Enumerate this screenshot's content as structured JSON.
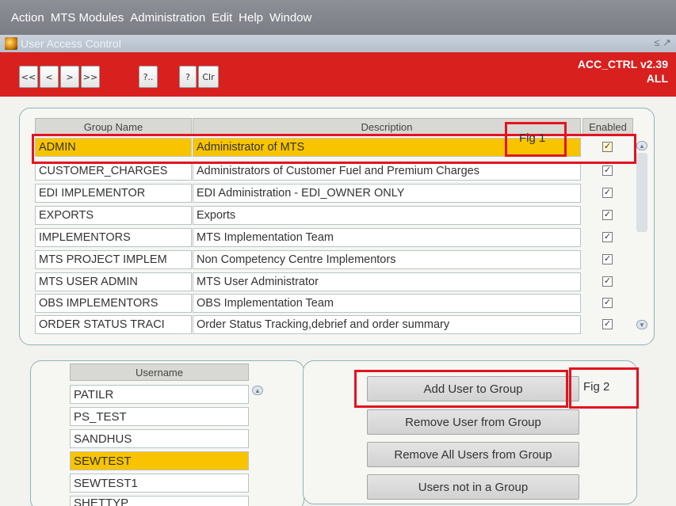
{
  "menu": {
    "items": [
      "Action",
      "MTS Modules",
      "Administration",
      "Edit",
      "Help",
      "Window"
    ]
  },
  "window": {
    "title": "User Access Control",
    "controls": "≤ ↗"
  },
  "toolbar": {
    "buttons": [
      "<<",
      "<",
      ">",
      ">>",
      "?..",
      "?",
      "Clr"
    ],
    "form_id": "ACC_CTRL v2.39",
    "scope": "ALL"
  },
  "groups": {
    "headers": {
      "name": "Group Name",
      "description": "Description",
      "enabled": "Enabled"
    },
    "rows": [
      {
        "name": "ADMIN",
        "description": "Administrator of MTS",
        "enabled": true
      },
      {
        "name": "CUSTOMER_CHARGES",
        "description": "Administrators of Customer Fuel and Premium Charges",
        "enabled": true
      },
      {
        "name": "EDI IMPLEMENTOR",
        "description": "EDI Administration - EDI_OWNER ONLY",
        "enabled": true
      },
      {
        "name": "EXPORTS",
        "description": "Exports",
        "enabled": true
      },
      {
        "name": "IMPLEMENTORS",
        "description": "MTS Implementation Team",
        "enabled": true
      },
      {
        "name": "MTS PROJECT IMPLEM",
        "description": "Non Competency Centre Implementors",
        "enabled": true
      },
      {
        "name": "MTS USER ADMIN",
        "description": "MTS User Administrator",
        "enabled": true
      },
      {
        "name": "OBS IMPLEMENTORS",
        "description": "OBS Implementation Team",
        "enabled": true
      },
      {
        "name": "ORDER STATUS TRACI",
        "description": "Order Status Tracking,debrief and order summary",
        "enabled": true
      }
    ],
    "selected_index": 0
  },
  "users": {
    "header": "Username",
    "rows": [
      "PATILR",
      "PS_TEST",
      "SANDHUS",
      "SEWTEST",
      "SEWTEST1",
      "SHETTYP"
    ],
    "selected_index": 3
  },
  "actions": {
    "add_user": "Add User to Group",
    "remove_user": "Remove User from Group",
    "remove_all": "Remove All Users from Group",
    "users_not_in_group": "Users not in a Group"
  },
  "annotations": {
    "fig1": "Fig 1",
    "fig2": "Fig 2"
  },
  "colors": {
    "toolbar_red": "#d8201f",
    "selected_row": "#f8c400",
    "annotation_red": "#e3141f"
  }
}
